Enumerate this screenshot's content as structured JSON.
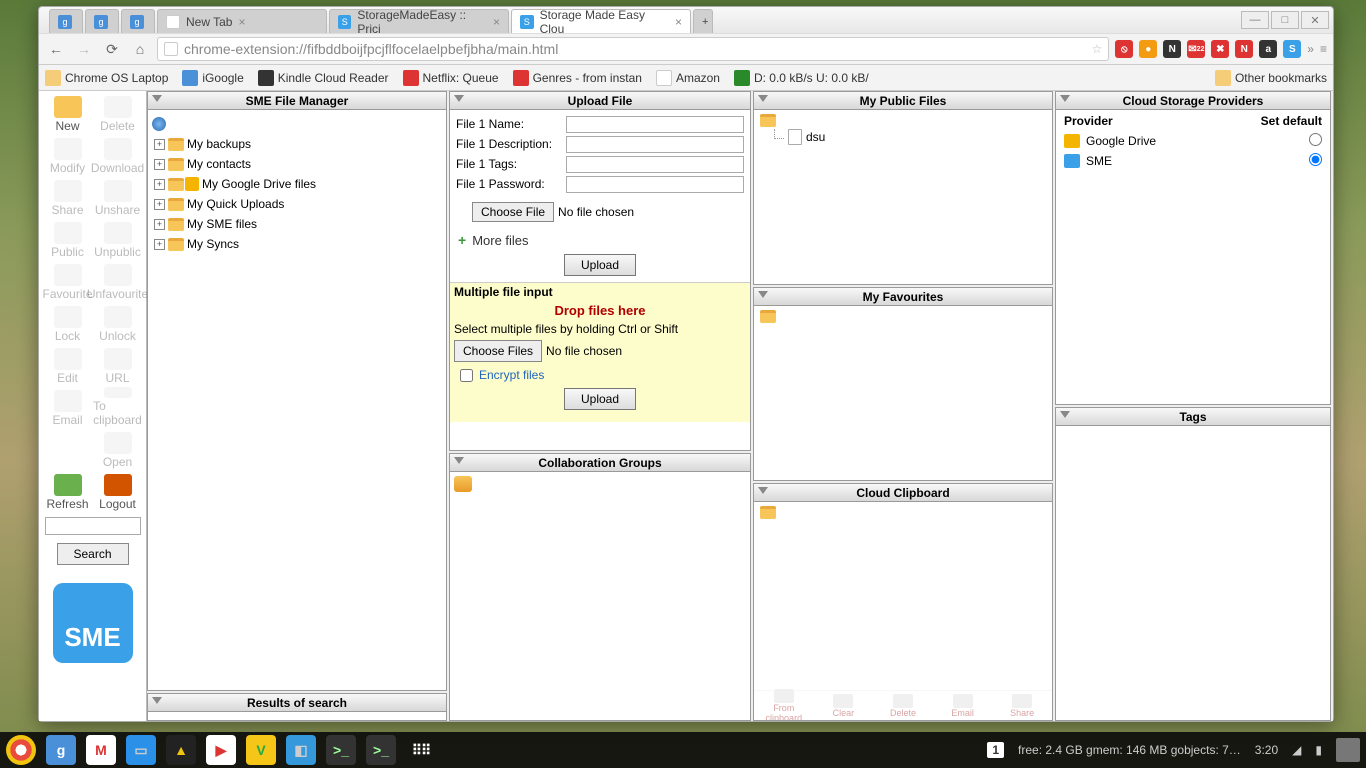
{
  "browser": {
    "tabs": [
      {
        "icon": "g",
        "label": "",
        "active": false
      },
      {
        "icon": "g",
        "label": "",
        "active": false
      },
      {
        "icon": "g",
        "label": "",
        "active": false
      },
      {
        "icon": "",
        "label": "New Tab",
        "active": false
      },
      {
        "icon": "SME",
        "label": "StorageMadeEasy :: Prici",
        "active": false
      },
      {
        "icon": "SME",
        "label": "Storage Made Easy Clou",
        "active": true
      }
    ],
    "url": "chrome-extension://fifbddboijfpcjflfocelaelpbefjbha/main.html",
    "bookmarks": [
      {
        "label": "Chrome OS Laptop"
      },
      {
        "label": "iGoogle"
      },
      {
        "label": "Kindle Cloud Reader"
      },
      {
        "label": "Netflix: Queue"
      },
      {
        "label": "Genres - from instan"
      },
      {
        "label": "Amazon"
      },
      {
        "label": "D: 0.0 kB/s U: 0.0 kB/"
      }
    ],
    "other_bookmarks": "Other bookmarks"
  },
  "sidebar": {
    "buttons": [
      {
        "label": "New",
        "enabled": true,
        "color": "#f7c558"
      },
      {
        "label": "Delete",
        "enabled": false,
        "color": "#e8e8e8"
      },
      {
        "label": "Modify",
        "enabled": false,
        "color": "#e8e8e8"
      },
      {
        "label": "Download",
        "enabled": false,
        "color": "#e8e8e8"
      },
      {
        "label": "Share",
        "enabled": false,
        "color": "#e8e8e8"
      },
      {
        "label": "Unshare",
        "enabled": false,
        "color": "#e8e8e8"
      },
      {
        "label": "Public",
        "enabled": false,
        "color": "#e8e8e8"
      },
      {
        "label": "Unpublic",
        "enabled": false,
        "color": "#e8e8e8"
      },
      {
        "label": "Favourite",
        "enabled": false,
        "color": "#e8e8e8"
      },
      {
        "label": "Unfavourite",
        "enabled": false,
        "color": "#e8e8e8"
      },
      {
        "label": "Lock",
        "enabled": false,
        "color": "#e8e8e8"
      },
      {
        "label": "Unlock",
        "enabled": false,
        "color": "#e8e8e8"
      },
      {
        "label": "Edit",
        "enabled": false,
        "color": "#e8e8e8"
      },
      {
        "label": "URL",
        "enabled": false,
        "color": "#e8e8e8"
      },
      {
        "label": "Email",
        "enabled": false,
        "color": "#e8e8e8"
      },
      {
        "label": "To clipboard",
        "enabled": false,
        "color": "#e8e8e8"
      },
      {
        "label": "",
        "enabled": false,
        "color": "transparent"
      },
      {
        "label": "Open",
        "enabled": false,
        "color": "#e8e8e8"
      },
      {
        "label": "Refresh",
        "enabled": true,
        "color": "#6ab04c"
      },
      {
        "label": "Logout",
        "enabled": true,
        "color": "#d35400"
      }
    ],
    "search_label": "Search",
    "logo": "SME"
  },
  "filemanager": {
    "title": "SME File Manager",
    "items": [
      "My backups",
      "My contacts",
      "My Google Drive files",
      "My Quick Uploads",
      "My SME files",
      "My Syncs"
    ]
  },
  "upload": {
    "title": "Upload File",
    "rows": [
      {
        "label": "File 1 Name:"
      },
      {
        "label": "File 1 Description:"
      },
      {
        "label": "File 1 Tags:"
      },
      {
        "label": "File 1 Password:"
      }
    ],
    "choose_file": "Choose File",
    "no_file": "No file chosen",
    "more_files": "More files",
    "upload_btn": "Upload",
    "multiple_hdr": "Multiple file input",
    "drop_here": "Drop files here",
    "hint": "Select multiple files by holding Ctrl or Shift",
    "choose_files": "Choose Files",
    "no_file2": "No file chosen",
    "encrypt": "Encrypt files",
    "upload_btn2": "Upload"
  },
  "collab": {
    "title": "Collaboration Groups"
  },
  "results": {
    "title": "Results of search"
  },
  "public": {
    "title": "My Public Files",
    "item": "dsu"
  },
  "fav": {
    "title": "My Favourites"
  },
  "clip": {
    "title": "Cloud Clipboard",
    "actions": [
      "From clipboard",
      "Clear",
      "Delete",
      "Email",
      "Share"
    ]
  },
  "providers": {
    "title": "Cloud Storage Providers",
    "col1": "Provider",
    "col2": "Set default",
    "rows": [
      {
        "name": "Google Drive",
        "default": false,
        "color": "#f4b400"
      },
      {
        "name": "SME",
        "default": true,
        "color": "#3aa0e8"
      }
    ]
  },
  "tags": {
    "title": "Tags"
  },
  "taskbar": {
    "status": "free: 2.4 GB  gmem: 146 MB  gobjects: 7…",
    "badge": "1",
    "time": "3:20"
  }
}
